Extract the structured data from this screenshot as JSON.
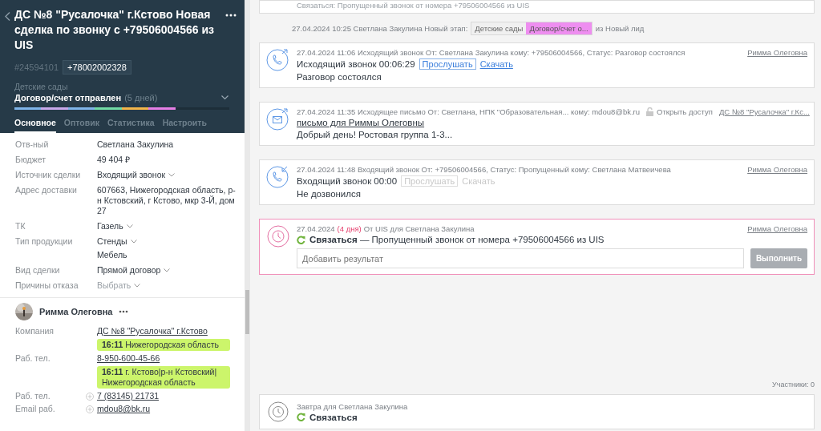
{
  "deal": {
    "title": "ДС №8 \"Русалочка\" г.Кстово Новая сделка по звонку с +79506004566 из UIS",
    "id": "#24594101",
    "phone": "+78002002328",
    "pipeline": "Детские сады",
    "stage": "Договор/счет отправлен",
    "stage_age": "(5 дней)",
    "progress": {
      "level": 0.75
    },
    "tabs": [
      {
        "label": "Основное",
        "selected": true
      },
      {
        "label": "Оптовик",
        "selected": false
      },
      {
        "label": "Статистика",
        "selected": false
      },
      {
        "label": "Настроить",
        "selected": false
      }
    ]
  },
  "fields": [
    {
      "label": "Отв-ный",
      "value": "Светлана Закулина",
      "kind": "text"
    },
    {
      "label": "Бюджет",
      "value": "49 404  ₽",
      "kind": "text"
    },
    {
      "label": "Источник сделки",
      "value": "Входящий звонок",
      "kind": "select"
    },
    {
      "label": "Адрес доставки",
      "value": "607663, Нижегородская область, р-н Кстовский, г Кстово, мкр 3-Й, дом 27",
      "kind": "text"
    },
    {
      "label": "ТК",
      "value": "Газель",
      "kind": "select"
    },
    {
      "label": "Тип продукции",
      "value": "Стенды",
      "kind": "select",
      "extra": "Мебель"
    },
    {
      "label": "Вид сделки",
      "value": "Прямой договор",
      "kind": "select"
    },
    {
      "label": "Причины отказа",
      "placeholder": "Выбрать",
      "kind": "select"
    }
  ],
  "contact": {
    "name": "Римма Олеговна",
    "rows": [
      {
        "label": "Компания",
        "value": "ДС №8 \"Русалочка\" г.Кстово",
        "tag": "**16:11** Нижегородская область"
      },
      {
        "label": "Раб. тел.",
        "value": "8-950-600-45-66",
        "tag": "**16:11** г. Кстово|р-н Кстовский| Нижегородская область"
      },
      {
        "label": "Раб. тел.",
        "value": "7 (83145) 21731",
        "add": true
      },
      {
        "label": "Email раб.",
        "value": "mdou8@bk.ru",
        "add": true
      }
    ]
  },
  "feed": {
    "cut_note": "Связаться: Пропущенный звонок от номера +79506004566 из UIS",
    "stage_change": {
      "text": "27.04.2024 10:25 Светлана Закулина Новый этап:",
      "pipeline": "Детские сады",
      "stage": "Договор/счет о...",
      "from": "из Новый лид"
    },
    "notes": [
      {
        "kind": "outgoing",
        "meta": "27.04.2024 11:06 Исходящий звонок От: Светлана Закулина кому: +79506004566, Статус: Разговор состоялся",
        "title": "Исходящий звонок 00:06:29",
        "listen": "Прослушать",
        "download": "Скачать",
        "enabled": true,
        "result": "Разговор состоялся",
        "author": "Римма Олеговна"
      },
      {
        "kind": "email",
        "meta": "27.04.2024 11:35 Исходящее письмо От: Светлана, НПК \"Образовательная... кому: mdou8@bk.ru",
        "subject": "письмо для Риммы Олеговны",
        "body": "Добрый день! Ростовая группа 1-3...",
        "access": "Открыть доступ",
        "link": "ДС №8 \"Русалочка\" г.Кс..."
      },
      {
        "kind": "incoming",
        "meta": "27.04.2024 11:48 Входящий звонок От: +79506004566, Статус: Пропущенный кому: Светлана Матвеичева",
        "title": "Входящий звонок 00:00",
        "listen": "Прослушать",
        "download": "Скачать",
        "enabled": false,
        "result": "Не дозвонился",
        "author": "Римма Олеговна"
      },
      {
        "kind": "task",
        "date": "27.04.2024",
        "overdue": "(4 дня)",
        "meta": "От UIS для Светлана Закулина",
        "text": "**Связаться** — Пропущенный звонок от номера +79506004566 из UIS",
        "placeholder": "Добавить результат",
        "button": "Выполнить",
        "author": "Римма Олеговна"
      }
    ],
    "participants": "Участники: 0",
    "upcoming": {
      "when": "Завтра для Светлана Закулина",
      "action": "Связаться"
    }
  }
}
